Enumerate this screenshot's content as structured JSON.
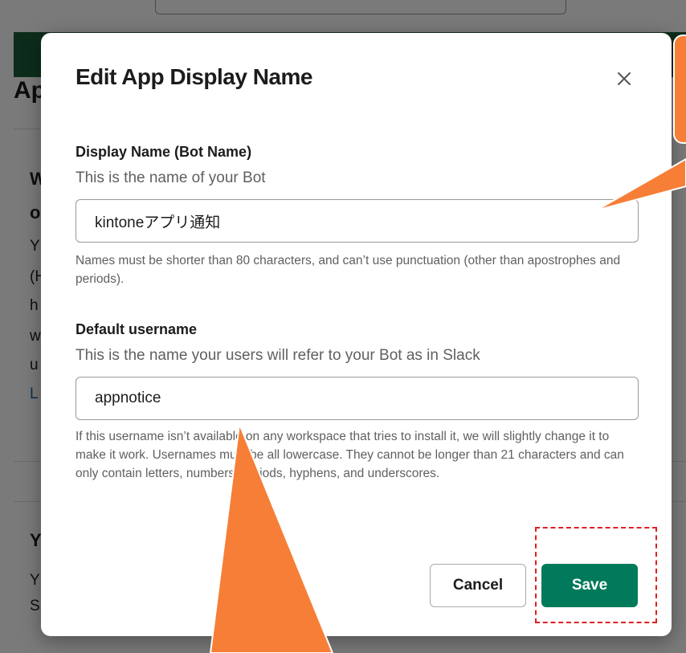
{
  "background": {
    "heading_fragment": "Ap",
    "text_fragments": [
      "W",
      "o",
      "Y",
      "(H",
      "h",
      "w",
      "u"
    ],
    "link_fragment": "L",
    "lower_heading_fragment": "Y",
    "lower_text_fragments": [
      "Y",
      "S"
    ]
  },
  "modal": {
    "title": "Edit App Display Name",
    "display_name": {
      "label": "Display Name (Bot Name)",
      "description": "This is the name of your Bot",
      "value": "kintoneアプリ通知",
      "hint": "Names must be shorter than 80 characters, and can’t use punctuation (other than apostrophes and periods)."
    },
    "default_username": {
      "label": "Default username",
      "description": "This is the name your users will refer to your Bot as in Slack",
      "value": "appnotice",
      "hint": "If this username isn’t available on any workspace that tries to install it, we will slightly change it to make it work. Usernames must be all lowercase. They cannot be longer than 21 characters and can only contain letters, numbers, periods, hyphens, and underscores."
    },
    "cancel_label": "Cancel",
    "save_label": "Save"
  },
  "colors": {
    "save_button": "#007a5a",
    "annotation_orange": "#f77e36",
    "annotation_dash": "#e02020",
    "bg_header_green": "#1d5c3a"
  },
  "icons": {
    "close": "close-icon"
  }
}
